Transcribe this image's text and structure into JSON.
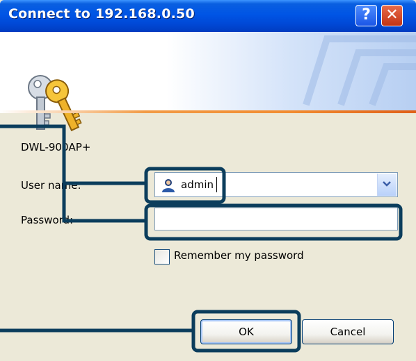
{
  "window": {
    "title": "Connect to 192.168.0.50",
    "help_label": "?",
    "close_label": "✕"
  },
  "dialog": {
    "site_name": "DWL-900AP+",
    "user_label": "User name:",
    "user_value": "admin",
    "password_label": "Password:",
    "password_value": "",
    "remember_label": "Remember my password",
    "remember_checked": false,
    "ok_label": "OK",
    "cancel_label": "Cancel"
  },
  "icons": {
    "banner": "keys-icon",
    "user": "user-icon",
    "dropdown": "chevron-down-icon"
  },
  "colors": {
    "titlebar": "#0055e5",
    "dialog_bg": "#ece9d8",
    "callout": "#0b3d5c",
    "banner_stripe": "#f28c30"
  }
}
